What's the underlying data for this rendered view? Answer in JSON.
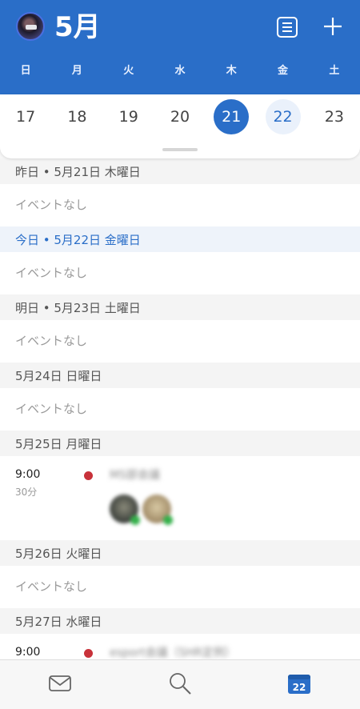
{
  "header": {
    "month_title": "5月",
    "weekdays": [
      "日",
      "月",
      "火",
      "水",
      "木",
      "金",
      "土"
    ]
  },
  "week": {
    "dates": [
      "17",
      "18",
      "19",
      "20",
      "21",
      "22",
      "23"
    ],
    "selected_index": 4,
    "today_index": 5
  },
  "agenda": {
    "day1": {
      "header": "昨日 • 5月21日 木曜日",
      "empty": "イベントなし"
    },
    "day2": {
      "header": "今日 • 5月22日 金曜日",
      "empty": "イベントなし"
    },
    "day3": {
      "header": "明日 • 5月23日 土曜日",
      "empty": "イベントなし"
    },
    "day4": {
      "header": "5月24日 日曜日",
      "empty": "イベントなし"
    },
    "day5": {
      "header": "5月25日 月曜日",
      "event": {
        "time": "9:00",
        "duration": "30分",
        "title": "MS部会議",
        "dot_color": "#c8323a"
      }
    },
    "day6": {
      "header": "5月26日 火曜日",
      "empty": "イベントなし"
    },
    "day7": {
      "header": "5月27日 水曜日",
      "event": {
        "time": "9:00",
        "title": "esport会議（SHR定例）",
        "dot_color": "#c8323a"
      }
    }
  },
  "tabbar": {
    "mail_icon": "mail-icon",
    "search_icon": "search-icon",
    "calendar_icon": "calendar-icon",
    "calendar_badge": "22",
    "active_color": "#2a6ec8"
  },
  "colors": {
    "accent": "#2a6ec8",
    "event_dot": "#c8323a"
  }
}
